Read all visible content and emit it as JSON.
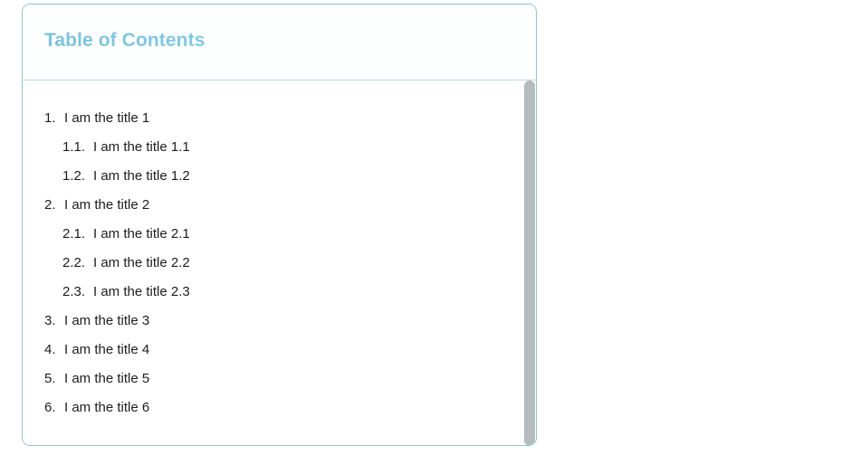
{
  "card": {
    "border_color": "#8cc8c4",
    "background_color": "#fdffff"
  },
  "header": {
    "title": "Table of Contents",
    "title_color": "#79c7e3",
    "divider_color": "#bcdedd"
  },
  "toc": {
    "items": [
      {
        "number": "1.",
        "label": "I am the title 1",
        "level": 1
      },
      {
        "number": "1.1.",
        "label": "I am the title 1.1",
        "level": 2
      },
      {
        "number": "1.2.",
        "label": "I am the title 1.2",
        "level": 2
      },
      {
        "number": "2.",
        "label": "I am the title 2",
        "level": 1
      },
      {
        "number": "2.1.",
        "label": "I am the title 2.1",
        "level": 2
      },
      {
        "number": "2.2.",
        "label": "I am the title 2.2",
        "level": 2
      },
      {
        "number": "2.3.",
        "label": "I am the title 2.3",
        "level": 2
      },
      {
        "number": "3.",
        "label": "I am the title 3",
        "level": 1
      },
      {
        "number": "4.",
        "label": "I am the title 4",
        "level": 1
      },
      {
        "number": "5.",
        "label": "I am the title 5",
        "level": 1
      },
      {
        "number": "6.",
        "label": "I am the title 6",
        "level": 1
      }
    ],
    "text_color": "#1d1d1d"
  },
  "scrollbar": {
    "thumb_color": "#b4bcc0",
    "orientation": "vertical"
  }
}
